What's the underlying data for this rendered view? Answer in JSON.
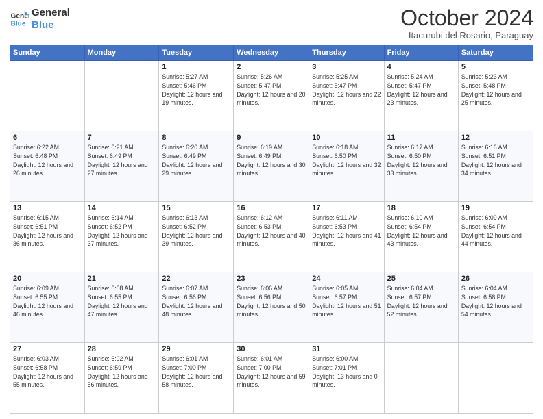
{
  "logo": {
    "line1": "General",
    "line2": "Blue"
  },
  "title": "October 2024",
  "subtitle": "Itacurubi del Rosario, Paraguay",
  "weekdays": [
    "Sunday",
    "Monday",
    "Tuesday",
    "Wednesday",
    "Thursday",
    "Friday",
    "Saturday"
  ],
  "weeks": [
    [
      {
        "day": "",
        "sunrise": "",
        "sunset": "",
        "daylight": ""
      },
      {
        "day": "",
        "sunrise": "",
        "sunset": "",
        "daylight": ""
      },
      {
        "day": "1",
        "sunrise": "Sunrise: 5:27 AM",
        "sunset": "Sunset: 5:46 PM",
        "daylight": "Daylight: 12 hours and 19 minutes."
      },
      {
        "day": "2",
        "sunrise": "Sunrise: 5:26 AM",
        "sunset": "Sunset: 5:47 PM",
        "daylight": "Daylight: 12 hours and 20 minutes."
      },
      {
        "day": "3",
        "sunrise": "Sunrise: 5:25 AM",
        "sunset": "Sunset: 5:47 PM",
        "daylight": "Daylight: 12 hours and 22 minutes."
      },
      {
        "day": "4",
        "sunrise": "Sunrise: 5:24 AM",
        "sunset": "Sunset: 5:47 PM",
        "daylight": "Daylight: 12 hours and 23 minutes."
      },
      {
        "day": "5",
        "sunrise": "Sunrise: 5:23 AM",
        "sunset": "Sunset: 5:48 PM",
        "daylight": "Daylight: 12 hours and 25 minutes."
      }
    ],
    [
      {
        "day": "6",
        "sunrise": "Sunrise: 6:22 AM",
        "sunset": "Sunset: 6:48 PM",
        "daylight": "Daylight: 12 hours and 26 minutes."
      },
      {
        "day": "7",
        "sunrise": "Sunrise: 6:21 AM",
        "sunset": "Sunset: 6:49 PM",
        "daylight": "Daylight: 12 hours and 27 minutes."
      },
      {
        "day": "8",
        "sunrise": "Sunrise: 6:20 AM",
        "sunset": "Sunset: 6:49 PM",
        "daylight": "Daylight: 12 hours and 29 minutes."
      },
      {
        "day": "9",
        "sunrise": "Sunrise: 6:19 AM",
        "sunset": "Sunset: 6:49 PM",
        "daylight": "Daylight: 12 hours and 30 minutes."
      },
      {
        "day": "10",
        "sunrise": "Sunrise: 6:18 AM",
        "sunset": "Sunset: 6:50 PM",
        "daylight": "Daylight: 12 hours and 32 minutes."
      },
      {
        "day": "11",
        "sunrise": "Sunrise: 6:17 AM",
        "sunset": "Sunset: 6:50 PM",
        "daylight": "Daylight: 12 hours and 33 minutes."
      },
      {
        "day": "12",
        "sunrise": "Sunrise: 6:16 AM",
        "sunset": "Sunset: 6:51 PM",
        "daylight": "Daylight: 12 hours and 34 minutes."
      }
    ],
    [
      {
        "day": "13",
        "sunrise": "Sunrise: 6:15 AM",
        "sunset": "Sunset: 6:51 PM",
        "daylight": "Daylight: 12 hours and 36 minutes."
      },
      {
        "day": "14",
        "sunrise": "Sunrise: 6:14 AM",
        "sunset": "Sunset: 6:52 PM",
        "daylight": "Daylight: 12 hours and 37 minutes."
      },
      {
        "day": "15",
        "sunrise": "Sunrise: 6:13 AM",
        "sunset": "Sunset: 6:52 PM",
        "daylight": "Daylight: 12 hours and 39 minutes."
      },
      {
        "day": "16",
        "sunrise": "Sunrise: 6:12 AM",
        "sunset": "Sunset: 6:53 PM",
        "daylight": "Daylight: 12 hours and 40 minutes."
      },
      {
        "day": "17",
        "sunrise": "Sunrise: 6:11 AM",
        "sunset": "Sunset: 6:53 PM",
        "daylight": "Daylight: 12 hours and 41 minutes."
      },
      {
        "day": "18",
        "sunrise": "Sunrise: 6:10 AM",
        "sunset": "Sunset: 6:54 PM",
        "daylight": "Daylight: 12 hours and 43 minutes."
      },
      {
        "day": "19",
        "sunrise": "Sunrise: 6:09 AM",
        "sunset": "Sunset: 6:54 PM",
        "daylight": "Daylight: 12 hours and 44 minutes."
      }
    ],
    [
      {
        "day": "20",
        "sunrise": "Sunrise: 6:09 AM",
        "sunset": "Sunset: 6:55 PM",
        "daylight": "Daylight: 12 hours and 46 minutes."
      },
      {
        "day": "21",
        "sunrise": "Sunrise: 6:08 AM",
        "sunset": "Sunset: 6:55 PM",
        "daylight": "Daylight: 12 hours and 47 minutes."
      },
      {
        "day": "22",
        "sunrise": "Sunrise: 6:07 AM",
        "sunset": "Sunset: 6:56 PM",
        "daylight": "Daylight: 12 hours and 48 minutes."
      },
      {
        "day": "23",
        "sunrise": "Sunrise: 6:06 AM",
        "sunset": "Sunset: 6:56 PM",
        "daylight": "Daylight: 12 hours and 50 minutes."
      },
      {
        "day": "24",
        "sunrise": "Sunrise: 6:05 AM",
        "sunset": "Sunset: 6:57 PM",
        "daylight": "Daylight: 12 hours and 51 minutes."
      },
      {
        "day": "25",
        "sunrise": "Sunrise: 6:04 AM",
        "sunset": "Sunset: 6:57 PM",
        "daylight": "Daylight: 12 hours and 52 minutes."
      },
      {
        "day": "26",
        "sunrise": "Sunrise: 6:04 AM",
        "sunset": "Sunset: 6:58 PM",
        "daylight": "Daylight: 12 hours and 54 minutes."
      }
    ],
    [
      {
        "day": "27",
        "sunrise": "Sunrise: 6:03 AM",
        "sunset": "Sunset: 6:58 PM",
        "daylight": "Daylight: 12 hours and 55 minutes."
      },
      {
        "day": "28",
        "sunrise": "Sunrise: 6:02 AM",
        "sunset": "Sunset: 6:59 PM",
        "daylight": "Daylight: 12 hours and 56 minutes."
      },
      {
        "day": "29",
        "sunrise": "Sunrise: 6:01 AM",
        "sunset": "Sunset: 7:00 PM",
        "daylight": "Daylight: 12 hours and 58 minutes."
      },
      {
        "day": "30",
        "sunrise": "Sunrise: 6:01 AM",
        "sunset": "Sunset: 7:00 PM",
        "daylight": "Daylight: 12 hours and 59 minutes."
      },
      {
        "day": "31",
        "sunrise": "Sunrise: 6:00 AM",
        "sunset": "Sunset: 7:01 PM",
        "daylight": "Daylight: 13 hours and 0 minutes."
      },
      {
        "day": "",
        "sunrise": "",
        "sunset": "",
        "daylight": ""
      },
      {
        "day": "",
        "sunrise": "",
        "sunset": "",
        "daylight": ""
      }
    ]
  ]
}
